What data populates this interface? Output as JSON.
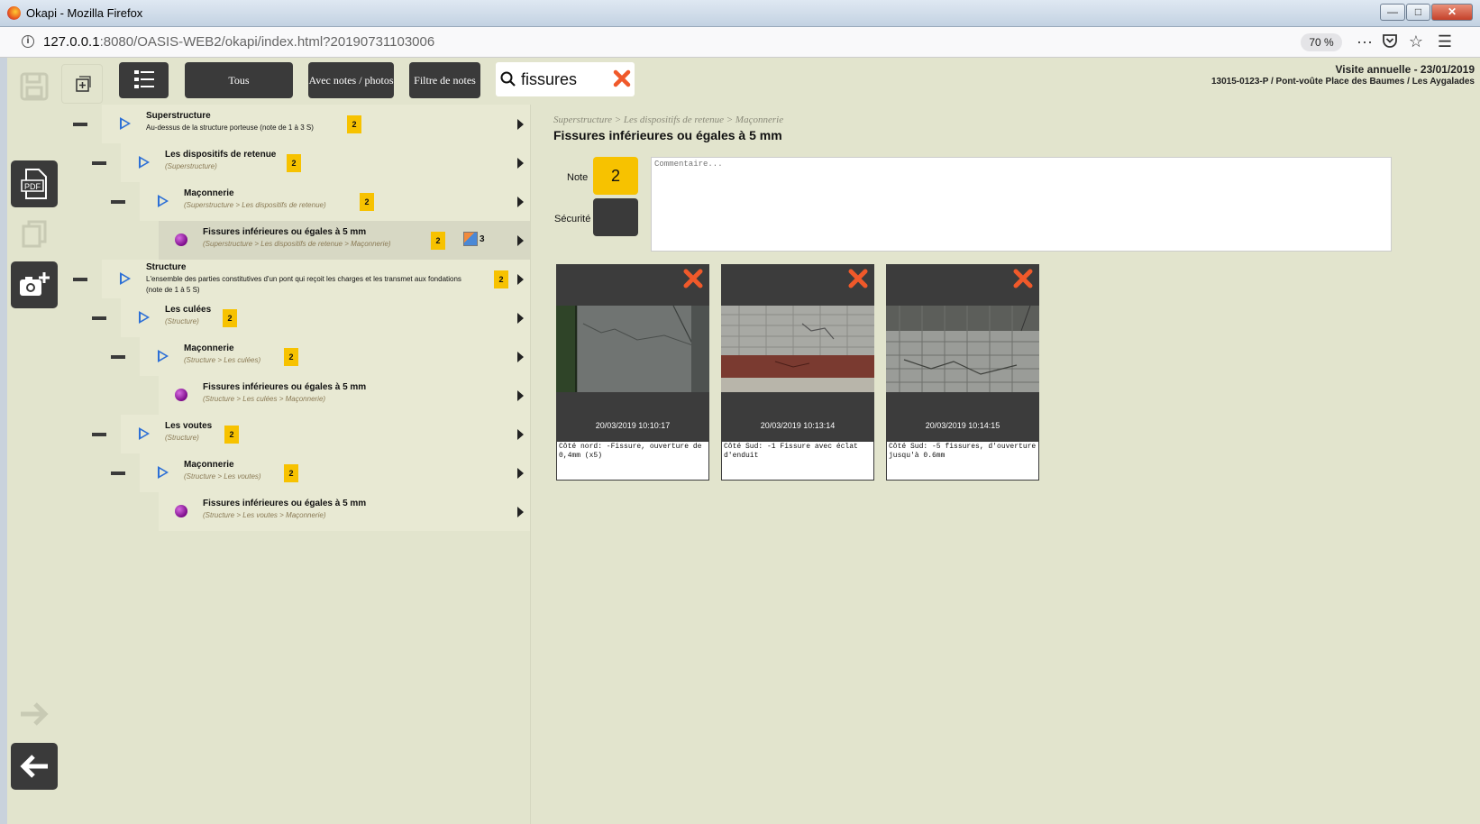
{
  "window": {
    "title": "Okapi - Mozilla Firefox"
  },
  "browser": {
    "url_host": "127.0.0.1",
    "url_path": ":8080/OASIS-WEB2/okapi/index.html?20190731103006",
    "zoom": "70 %"
  },
  "toolbar": {
    "btn_all": "Tous",
    "btn_notes_photos": "Avec notes / photos",
    "btn_filter": "Filtre de notes",
    "search_value": "fissures"
  },
  "visit": {
    "line1": "Visite annuelle - 23/01/2019",
    "line2": "13015-0123-P / Pont-voûte Place des Baumes / Les Aygalades"
  },
  "tree": [
    {
      "label": "Superstructure",
      "desc": "Au-dessus de la structure porteuse (note de 1 à 3 S)",
      "note": "2"
    },
    {
      "label": "Les dispositifs de retenue",
      "path": "(Superstructure)",
      "note": "2"
    },
    {
      "label": "Maçonnerie",
      "path": "(Superstructure > Les dispositifs de retenue)",
      "note": "2"
    },
    {
      "label": "Fissures inférieures ou égales à 5 mm",
      "path": "(Superstructure > Les dispositifs de retenue > Maçonnerie)",
      "note": "2",
      "photos": "3"
    },
    {
      "label": "Structure",
      "desc": "L'ensemble des parties constitutives d'un pont qui reçoit les charges et les transmet aux fondations (note de 1 à 5 S)",
      "note": "2"
    },
    {
      "label": "Les culées",
      "path": "(Structure)",
      "note": "2"
    },
    {
      "label": "Maçonnerie",
      "path": "(Structure > Les culées)",
      "note": "2"
    },
    {
      "label": "Fissures inférieures ou égales à 5 mm",
      "path": "(Structure > Les culées > Maçonnerie)"
    },
    {
      "label": "Les voutes",
      "path": "(Structure)",
      "note": "2"
    },
    {
      "label": "Maçonnerie",
      "path": "(Structure > Les voutes)",
      "note": "2"
    },
    {
      "label": "Fissures inférieures ou égales à 5 mm",
      "path": "(Structure > Les voutes > Maçonnerie)"
    }
  ],
  "detail": {
    "breadcrumb": "Superstructure > Les dispositifs de retenue > Maçonnerie",
    "title": "Fissures inférieures ou égales à 5 mm",
    "note_label": "Note",
    "note_value": "2",
    "security_label": "Sécurité",
    "comment_placeholder": "Commentaire..."
  },
  "photos": [
    {
      "date": "20/03/2019 10:10:17",
      "caption": "Côté nord:  -Fissure, ouverture de 0,4mm (x5)"
    },
    {
      "date": "20/03/2019 10:13:14",
      "caption": "Côté Sud: -1 Fissure avec éclat d'enduit"
    },
    {
      "date": "20/03/2019 10:14:15",
      "caption": "Côté Sud: -5 fissures, d'ouverture jusqu'à 0.6mm"
    }
  ],
  "colors": {
    "app_bg": "#e2e4cd",
    "dark": "#3a3a3a",
    "note_yellow": "#f7c200",
    "delete_orange": "#f0592a",
    "tree_play": "#2c6fd6",
    "leaf_dot": "#7c0b8a"
  }
}
